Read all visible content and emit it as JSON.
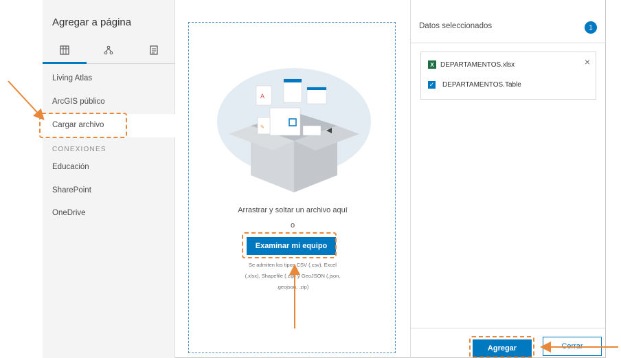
{
  "sidebar": {
    "title": "Agregar a página",
    "tabs": [
      {
        "icon": "layers-icon"
      },
      {
        "icon": "sitemap-icon"
      },
      {
        "icon": "document-icon"
      }
    ],
    "items": [
      {
        "label": "Living Atlas"
      },
      {
        "label": "ArcGIS público"
      },
      {
        "label": "Cargar archivo",
        "selected": true
      }
    ],
    "section_label": "CONEXIONES",
    "connections": [
      {
        "label": "Educación"
      },
      {
        "label": "SharePoint"
      },
      {
        "label": "OneDrive"
      }
    ]
  },
  "main": {
    "drop_text": "Arrastrar y soltar un archivo aquí",
    "or_text": "o",
    "browse_label": "Examinar mi equipo",
    "supported_text": "Se admiten los tipos CSV (.csv), Excel (.xlsx), Shapefile (.zip) y GeoJSON (.json, .geojson, .zip)"
  },
  "right_panel": {
    "title": "Datos seleccionados",
    "count": "1",
    "file_name": "DEPARTAMENTOS.xlsx",
    "table_name": "DEPARTAMENTOS.Table"
  },
  "footer": {
    "add_label": "Agregar",
    "close_label": "Cerrar"
  },
  "colors": {
    "accent": "#0079c1",
    "annotation": "#e8883a",
    "excel": "#1d6f42"
  }
}
